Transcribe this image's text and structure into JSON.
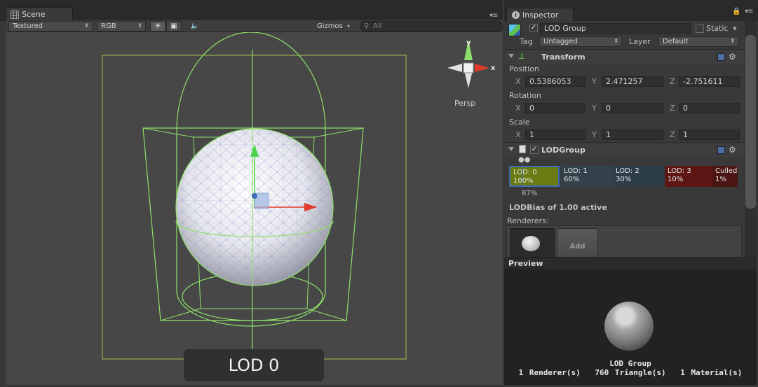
{
  "scene": {
    "tab_label": "Scene",
    "toolbar": {
      "render_mode": "Textured",
      "color_mode": "RGB",
      "gizmos_label": "Gizmos",
      "search_placeholder": "All"
    },
    "lod_overlay": "LOD 0",
    "gizmo": {
      "x_label": "x",
      "y_label": "y",
      "projection": "Persp"
    }
  },
  "inspector": {
    "tab_label": "Inspector",
    "object": {
      "name": "LOD Group",
      "active": true,
      "static_label": "Static",
      "static": false,
      "tag_label": "Tag",
      "tag_value": "Untagged",
      "layer_label": "Layer",
      "layer_value": "Default"
    },
    "transform": {
      "title": "Transform",
      "position_label": "Position",
      "position": {
        "x": "0.5386053",
        "y": "2.471257",
        "z": "-2.751611"
      },
      "rotation_label": "Rotation",
      "rotation": {
        "x": "0",
        "y": "0",
        "z": "0"
      },
      "scale_label": "Scale",
      "scale": {
        "x": "1",
        "y": "1",
        "z": "1"
      },
      "axis_x": "X",
      "axis_y": "Y",
      "axis_z": "Z"
    },
    "lodgroup": {
      "title": "LODGroup",
      "enabled": true,
      "segments": [
        {
          "name": "LOD: 0",
          "pct": "100%",
          "color": "#6b7a12"
        },
        {
          "name": "LOD: 1",
          "pct": "60%",
          "color": "#32414a"
        },
        {
          "name": "LOD: 2",
          "pct": "30%",
          "color": "#2e3e49"
        },
        {
          "name": "LOD: 3",
          "pct": "10%",
          "color": "#5c1714"
        },
        {
          "name": "Culled",
          "pct": "1%",
          "color": "#4a1512"
        }
      ],
      "current_pct": "87%",
      "bias_text": "LODBias of 1.00 active",
      "renderers_label": "Renderers:",
      "add_label": "Add"
    },
    "preview": {
      "title": "Preview",
      "object_name": "LOD Group",
      "renderers": "1 Renderer(s)",
      "triangles": "760 Triangle(s)",
      "materials": "1 Material(s)"
    }
  },
  "colors": {
    "wire_green": "#8ee06a",
    "accent_blue": "#3f6bb5",
    "axis_red": "#d13b2b"
  }
}
